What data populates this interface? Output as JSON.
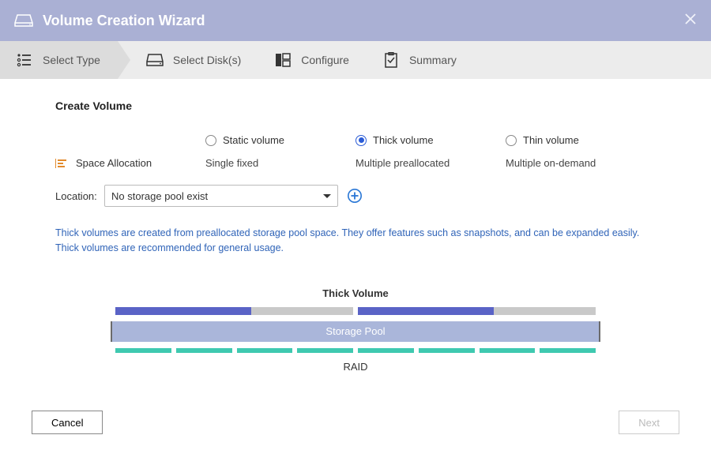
{
  "header": {
    "title": "Volume Creation Wizard"
  },
  "steps": [
    {
      "label": "Select Type",
      "active": true
    },
    {
      "label": "Select Disk(s)",
      "active": false
    },
    {
      "label": "Configure",
      "active": false
    },
    {
      "label": "Summary",
      "active": false
    }
  ],
  "section_title": "Create Volume",
  "volume_types": {
    "static": {
      "label": "Static volume",
      "allocation": "Single fixed"
    },
    "thick": {
      "label": "Thick volume",
      "allocation": "Multiple preallocated"
    },
    "thin": {
      "label": "Thin volume",
      "allocation": "Multiple on-demand"
    },
    "selected": "thick",
    "allocation_row_label": "Space Allocation"
  },
  "location": {
    "label": "Location:",
    "value": "No storage pool exist"
  },
  "note": "Thick volumes are created from preallocated storage pool space. They offer features such as snapshots, and can be expanded easily. Thick volumes are recommended for general usage.",
  "diagram": {
    "title": "Thick Volume",
    "pool_label": "Storage Pool",
    "raid_label": "RAID",
    "volume_fill_percent": [
      57,
      57
    ],
    "raid_segments": 8
  },
  "footer": {
    "cancel": "Cancel",
    "next": "Next",
    "next_enabled": false
  }
}
